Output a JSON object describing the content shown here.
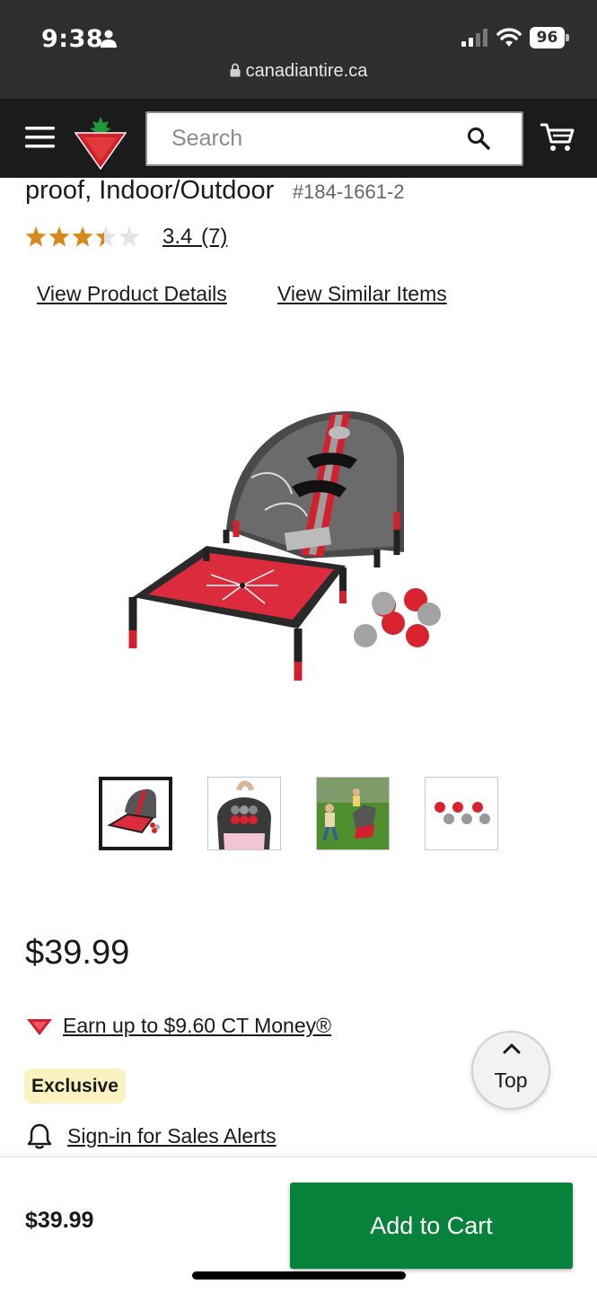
{
  "status_bar": {
    "time": "9:38",
    "battery": "96"
  },
  "browser": {
    "url": "canadiantire.ca"
  },
  "header": {
    "search_placeholder": "Search"
  },
  "product": {
    "title": "proof, Indoor/Outdoor",
    "sku": "#184-1661-2",
    "rating_value": 3.4,
    "rating_text": "3.4 (7)",
    "view_details": "View Product Details",
    "view_similar": "View Similar Items",
    "thumbnail_count": 4,
    "selected_thumbnail": 1,
    "price": "$39.99",
    "ct_money": "Earn up to $9.60 CT Money®",
    "badge": "Exclusive",
    "sales_alerts": "Sign-in for Sales Alerts"
  },
  "top_button": {
    "label": "Top"
  },
  "bottom_bar": {
    "price": "$39.99",
    "add_to_cart": "Add to Cart"
  },
  "colors": {
    "brand_red": "#d2202f",
    "cta_green": "#06823a",
    "star_gold": "#d7891c",
    "badge_bg": "#fbf2c2"
  },
  "icons": [
    "person-icon",
    "signal-icon",
    "wifi-icon",
    "battery-icon",
    "lock-icon",
    "menu-icon",
    "canadian-tire-logo",
    "search-icon",
    "cart-icon",
    "star-icon",
    "ct-triangle-icon",
    "bell-icon",
    "chevron-up-icon"
  ]
}
